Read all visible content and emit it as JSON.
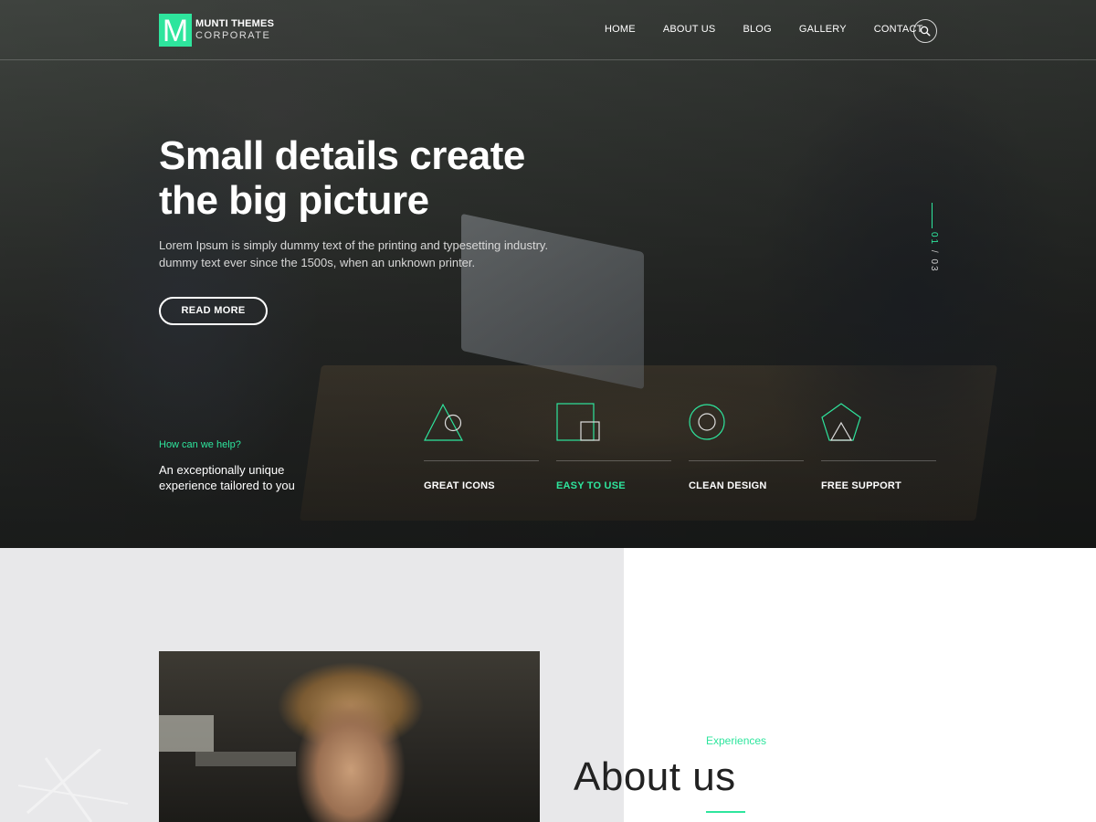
{
  "brand": {
    "mark": "M",
    "title": "MUNTI THEMES",
    "subtitle": "CORPORATE",
    "accent": "#2ee59d"
  },
  "nav": {
    "items": [
      {
        "label": "HOME"
      },
      {
        "label": "ABOUT US"
      },
      {
        "label": "BLOG"
      },
      {
        "label": "GALLERY"
      },
      {
        "label": "CONTACT"
      }
    ],
    "search_icon": "search-icon"
  },
  "hero": {
    "title_line1": "Small details create",
    "title_line2": "the big picture",
    "description": "Lorem Ipsum is simply dummy text of the printing and typesetting industry. dummy text ever since the 1500s, when an unknown printer.",
    "button": "READ MORE",
    "slide_current": "01",
    "slide_separator": "/",
    "slide_total": "03"
  },
  "help": {
    "label": "How can we help?",
    "text": "An exceptionally unique experience tailored to you"
  },
  "features": [
    {
      "label": "GREAT ICONS",
      "icon": "triangle-circle-icon",
      "active": false
    },
    {
      "label": "EASY TO USE",
      "icon": "squares-icon",
      "active": true
    },
    {
      "label": "CLEAN DESIGN",
      "icon": "circle-icon",
      "active": false
    },
    {
      "label": "FREE SUPPORT",
      "icon": "pentagon-icon",
      "active": false
    }
  ],
  "about": {
    "kicker": "Experiences",
    "title": "About us"
  }
}
